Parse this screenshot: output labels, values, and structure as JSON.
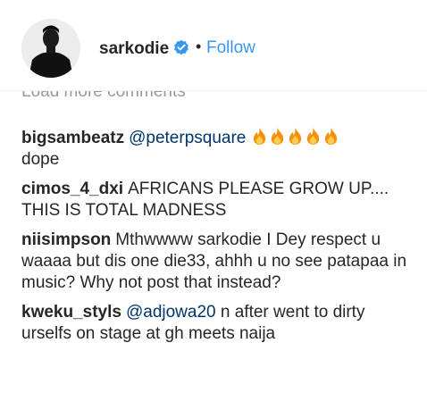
{
  "post_header": {
    "username": "sarkodie",
    "separator": "•",
    "follow_label": "Follow"
  },
  "load_more": "Load more comments",
  "comments": [
    {
      "user": "bigsambeatz",
      "mention": "@peterpsquare",
      "emoji": "fire-emoji",
      "emoji_count": 5,
      "text": "dope"
    },
    {
      "user": "cimos_4_dxi",
      "text": "AFRICANS PLEASE GROW UP.... THIS IS TOTAL MADNESS"
    },
    {
      "user": "niisimpson",
      "text": "Mthwwww sarkodie I Dey respect u waaaa but dis one die33, ahhh u no see patapaa in music? Why not post that instead?"
    },
    {
      "user": "kweku_styls",
      "mention": "@adjowa20",
      "text": "n after went to dirty urselfs on stage at gh meets naija"
    }
  ],
  "colors": {
    "link": "#3897f0",
    "text": "#262626",
    "mention": "#003569",
    "muted": "#999999"
  }
}
